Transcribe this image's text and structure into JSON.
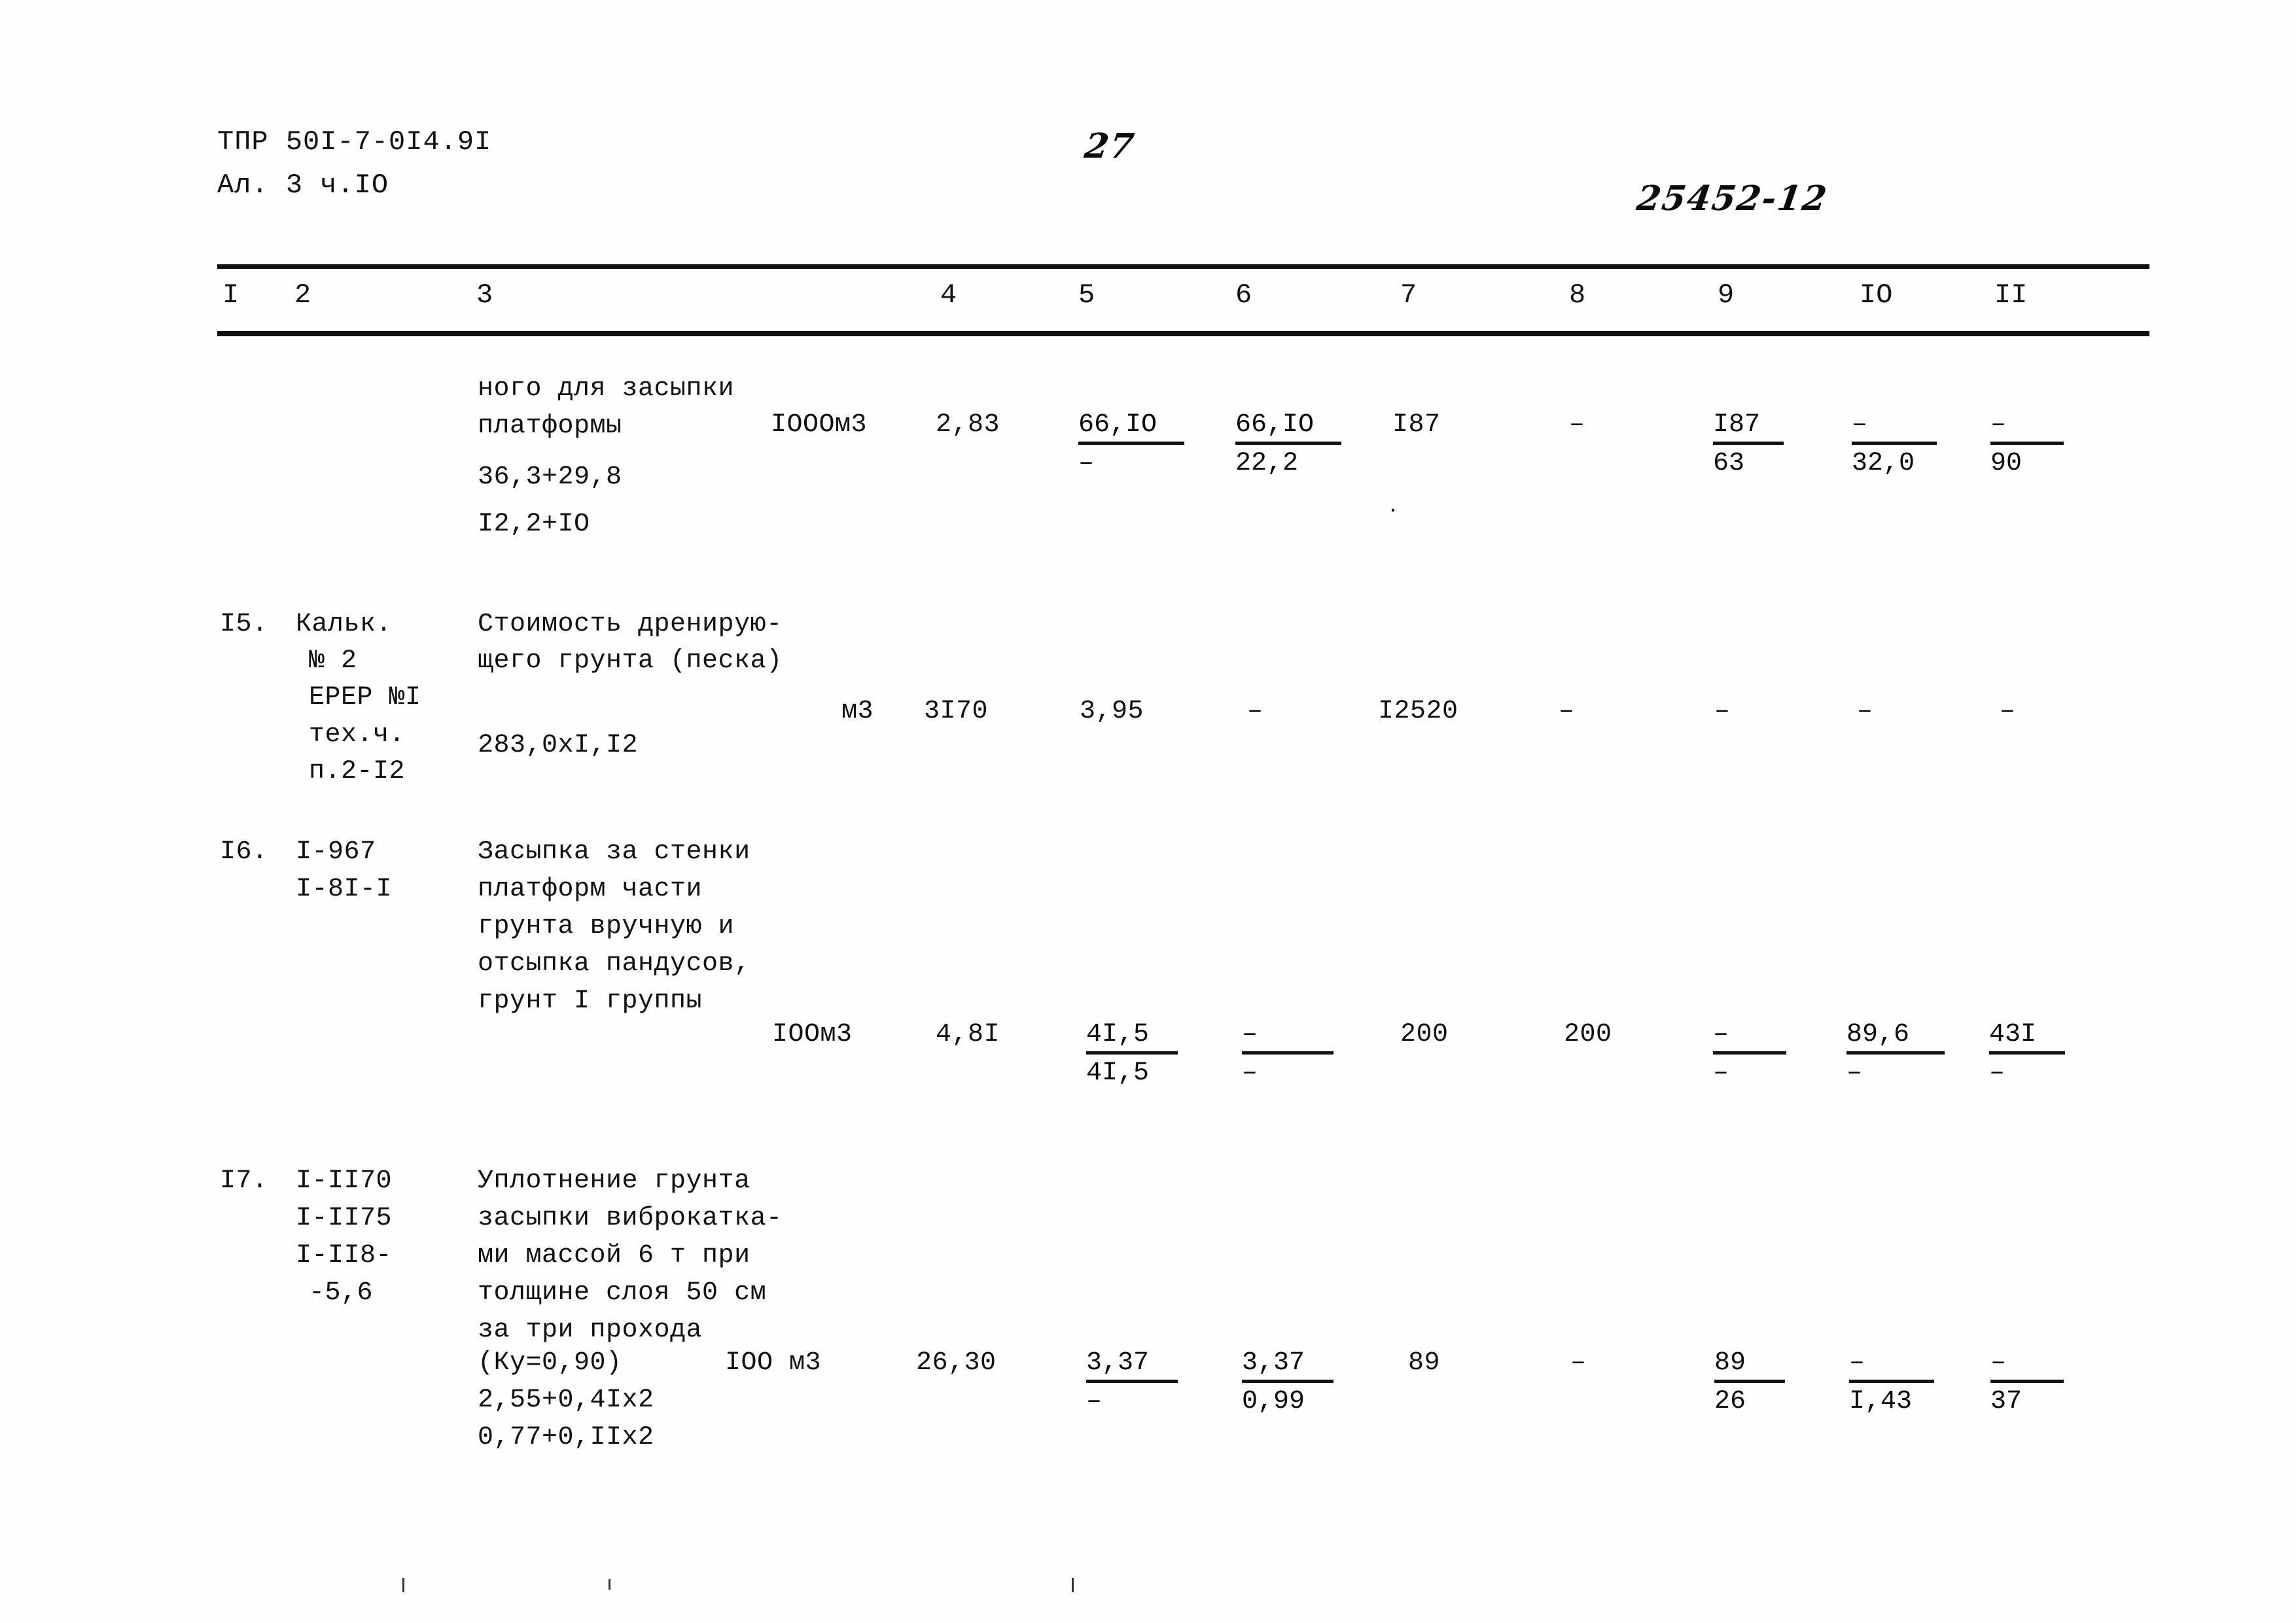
{
  "document": {
    "header": {
      "code_line1": "ТПР 50I-7-0I4.9I",
      "code_line2": "Ал. 3 ч.IO",
      "page_number_handwritten": "27",
      "archive_stamp_handwritten": "25452-12"
    },
    "table": {
      "column_headers": [
        "I",
        "2",
        "3",
        "4",
        "5",
        "6",
        "7",
        "8",
        "9",
        "IO",
        "II"
      ],
      "rows": [
        {
          "num": "",
          "code": "",
          "description_lines": [
            "ного для засыпки",
            "платформы"
          ],
          "calc_lines": [
            "36,3+29,8",
            "I2,2+IO"
          ],
          "unit": "IOOOм3",
          "c4": "2,83",
          "c5_num": "66,IO",
          "c5_den": "–",
          "c6_num": "66,IO",
          "c6_den": "22,2",
          "c7": "I87",
          "c8": "–",
          "c9_num": "I87",
          "c9_den": "63",
          "c10_num": "–",
          "c10_den": "32,0",
          "c11_num": "–",
          "c11_den": "90"
        },
        {
          "num": "I5.",
          "code_lines": [
            "Кальк.",
            "№ 2",
            "ЕРЕР №I",
            "тех.ч.",
            "п.2-I2"
          ],
          "description_lines": [
            "Стоимость дренирую-",
            "щего грунта (песка)"
          ],
          "calc_lines": [
            "283,0хI,I2"
          ],
          "unit": "м3",
          "c4": "3I70",
          "c5": "3,95",
          "c6": "–",
          "c7": "I2520",
          "c8": "–",
          "c9": "–",
          "c10": "–",
          "c11": "–"
        },
        {
          "num": "I6.",
          "code_lines": [
            "I-967",
            "I-8I-I"
          ],
          "description_lines": [
            "Засыпка за стенки",
            "платформ части",
            "грунта вручную и",
            "отсыпка пандусов,",
            "грунт I группы"
          ],
          "unit": "IOOм3",
          "c4": "4,8I",
          "c5_num": "4I,5",
          "c5_den": "4I,5",
          "c6_num": "–",
          "c6_den": "–",
          "c7": "200",
          "c8": "200",
          "c9_num": "–",
          "c9_den": "–",
          "c10_num": "89,6",
          "c10_den": "–",
          "c11_num": "43I",
          "c11_den": "–"
        },
        {
          "num": "I7.",
          "code_lines": [
            "I-II70",
            "I-II75",
            "I-II8-",
            "-5,6"
          ],
          "description_lines": [
            "Уплотнение грунта",
            "засыпки виброкатка-",
            "ми массой 6 т при",
            "толщине слоя 50 см",
            "за три прохода",
            "(Ку=0,90)"
          ],
          "calc_lines": [
            "2,55+0,4Iх2",
            "0,77+0,IIх2"
          ],
          "unit": "IOO м3",
          "c4": "26,30",
          "c5_num": "3,37",
          "c5_den": "–",
          "c6_num": "3,37",
          "c6_den": "0,99",
          "c7": "89",
          "c8": "–",
          "c9_num": "89",
          "c9_den": "26",
          "c10_num": "–",
          "c10_den": "I,43",
          "c11_num": "–",
          "c11_den": "37"
        }
      ]
    }
  }
}
